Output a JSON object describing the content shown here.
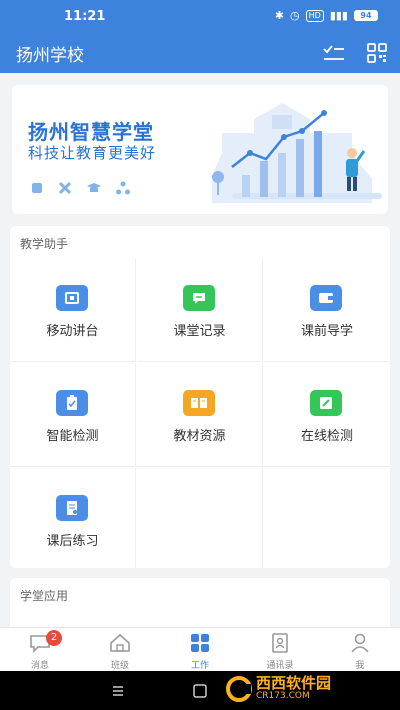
{
  "status_bar": {
    "time": "11:21",
    "battery": "94"
  },
  "header": {
    "title": "扬州学校"
  },
  "banner": {
    "title": "扬州智慧学堂",
    "subtitle": "科技让教育更美好"
  },
  "teaching": {
    "title": "教学助手",
    "items": [
      {
        "label": "移动讲台",
        "color": "#4a8ee6",
        "icon": "board-icon"
      },
      {
        "label": "课堂记录",
        "color": "#35c65a",
        "icon": "chat-icon"
      },
      {
        "label": "课前导学",
        "color": "#4a8ee6",
        "icon": "wallet-icon"
      },
      {
        "label": "智能检测",
        "color": "#4a8ee6",
        "icon": "clipboard-icon"
      },
      {
        "label": "教材资源",
        "color": "#f5a623",
        "icon": "book-icon"
      },
      {
        "label": "在线检测",
        "color": "#35c65a",
        "icon": "edit-icon"
      },
      {
        "label": "课后练习",
        "color": "#4a8ee6",
        "icon": "document-icon"
      }
    ]
  },
  "apps": {
    "title": "学堂应用"
  },
  "tabbar": {
    "tabs": [
      {
        "label": "消息",
        "badge": "2",
        "icon": "message-icon"
      },
      {
        "label": "班级",
        "icon": "home-icon"
      },
      {
        "label": "工作",
        "icon": "grid-icon",
        "active": true
      },
      {
        "label": "通讯录",
        "icon": "contacts-icon"
      },
      {
        "label": "我",
        "icon": "user-icon"
      }
    ]
  },
  "watermark": {
    "brand": "西西软件园",
    "domain": "CR173.COM"
  }
}
